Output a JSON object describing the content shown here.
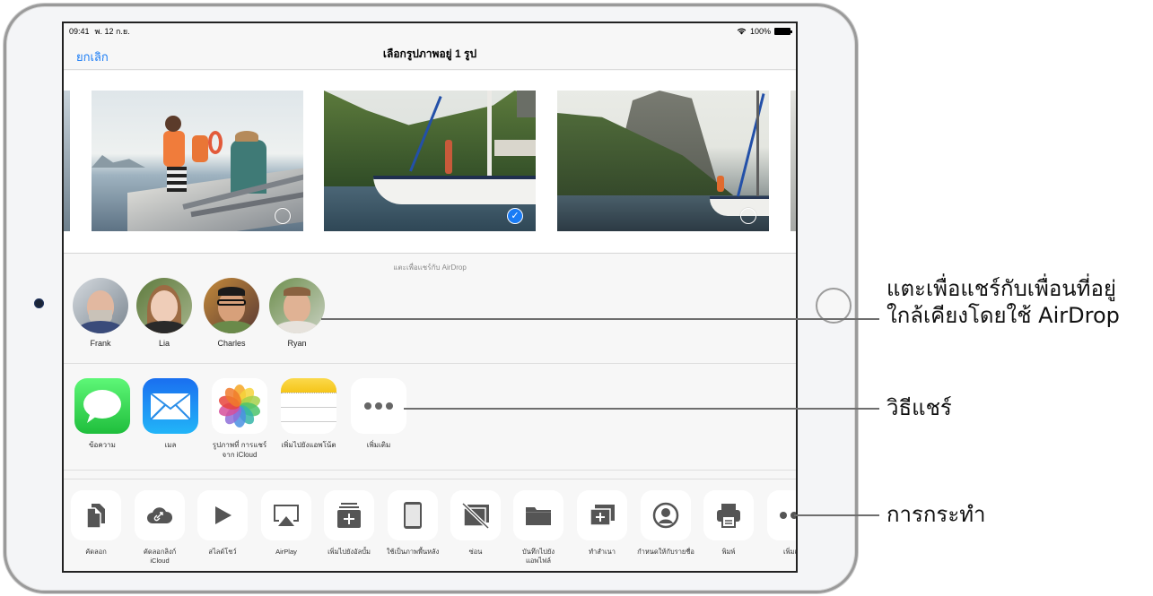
{
  "status_bar": {
    "time": "09:41",
    "date": "พ. 12 ก.ย.",
    "battery": "100%"
  },
  "nav": {
    "cancel_label": "ยกเลิก",
    "title": "เลือกรูปภาพอยู่ 1 รูป"
  },
  "photos": [
    {
      "name": "family-on-boat",
      "selected": false
    },
    {
      "name": "sailboat-near-hill",
      "selected": true
    },
    {
      "name": "sailboat-sugarloaf",
      "selected": false
    }
  ],
  "airdrop": {
    "hint": "แตะเพื่อแชร์กับ AirDrop",
    "people": [
      {
        "name": "Frank"
      },
      {
        "name": "Lia"
      },
      {
        "name": "Charles"
      },
      {
        "name": "Ryan"
      }
    ]
  },
  "share_apps": [
    {
      "label": "ข้อความ",
      "icon": "messages-icon"
    },
    {
      "label": "เมล",
      "icon": "mail-icon"
    },
    {
      "label": "รูปภาพที่ การแชร์\nจาก iCloud",
      "label_line1": "รูปภาพที่ การแชร์",
      "label_line2": "จาก iCloud",
      "icon": "photos-icon"
    },
    {
      "label": "เพิ่มไปยังแอพโน้ต",
      "icon": "notes-icon"
    },
    {
      "label": "เพิ่มเติม",
      "icon": "more-icon"
    }
  ],
  "actions": [
    {
      "label": "คัดลอก",
      "icon": "copy-icon"
    },
    {
      "label_line1": "คัดลอกลิงก์",
      "label_line2": "iCloud",
      "icon": "icloud-link-icon"
    },
    {
      "label": "สไลด์โชว์",
      "icon": "slideshow-icon"
    },
    {
      "label": "AirPlay",
      "icon": "airplay-icon"
    },
    {
      "label": "เพิ่มไปยังอัลบั้ม",
      "icon": "add-to-album-icon"
    },
    {
      "label": "ใช้เป็นภาพพื้นหลัง",
      "icon": "wallpaper-icon"
    },
    {
      "label": "ซ่อน",
      "icon": "hide-icon"
    },
    {
      "label_line1": "บันทึกไปยัง",
      "label_line2": "แอพไฟล์",
      "icon": "files-icon"
    },
    {
      "label": "ทำสำเนา",
      "icon": "duplicate-icon"
    },
    {
      "label": "กำหนดให้กับรายชื่อ",
      "icon": "assign-contact-icon"
    },
    {
      "label": "พิมพ์",
      "icon": "print-icon"
    },
    {
      "label": "เพิ่มเติ",
      "icon": "more-actions-icon"
    }
  ],
  "callouts": {
    "airdrop_line1": "แตะเพื่อแชร์กับเพื่อนที่อยู่",
    "airdrop_line2": "ใกล้เคียงโดยใช้ AirDrop",
    "share_methods": "วิธีแชร์",
    "actions": "การกระทำ"
  },
  "colors": {
    "accent": "#1a7cf5",
    "messages_green": "#34c759",
    "mail_blue": "#1d8bf1",
    "notes_yellow": "#f8d23a",
    "action_glyph": "#555555"
  }
}
